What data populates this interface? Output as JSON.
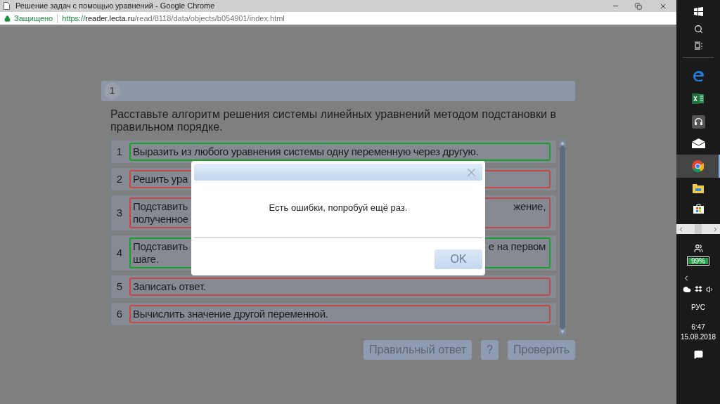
{
  "window": {
    "title": "Решение задач с помощью уравнений - Google Chrome"
  },
  "address_bar": {
    "security": "Защищено",
    "url_scheme": "https://",
    "url_host": "reader.lecta.ru",
    "url_path": "/read/8118/data/objects/b054901/index.html"
  },
  "task": {
    "number": "1",
    "question": "Расставьте алгоритм решения системы линейных уравнений методом подстановки в правильном порядке.",
    "items": [
      {
        "number": "1",
        "correct": true,
        "lines": [
          {
            "left": "Выразить из любого уравнения системы одну переменную через другую."
          }
        ]
      },
      {
        "number": "2",
        "correct": false,
        "lines": [
          {
            "left": "Решить ура"
          }
        ]
      },
      {
        "number": "3",
        "correct": false,
        "lines": [
          {
            "left": "Подставить",
            "right": "жение,"
          },
          {
            "left": "полученное"
          }
        ]
      },
      {
        "number": "4",
        "correct": true,
        "lines": [
          {
            "left": "Подставить",
            "right": "е на первом"
          },
          {
            "left": "шаге."
          }
        ]
      },
      {
        "number": "5",
        "correct": false,
        "lines": [
          {
            "left": "Записать ответ."
          }
        ]
      },
      {
        "number": "6",
        "correct": false,
        "lines": [
          {
            "left": "Вычислить значение другой переменной."
          }
        ]
      }
    ],
    "buttons": [
      {
        "label": "Правильный ответ"
      },
      {
        "label": "?"
      },
      {
        "label": "Проверить"
      }
    ]
  },
  "dialog": {
    "message": "Есть ошибки, попробуй ещё раз.",
    "ok": "OK"
  },
  "taskbar": {
    "battery": "99%",
    "language": "РУС",
    "time": "6:47",
    "date": "15.08.2018"
  }
}
